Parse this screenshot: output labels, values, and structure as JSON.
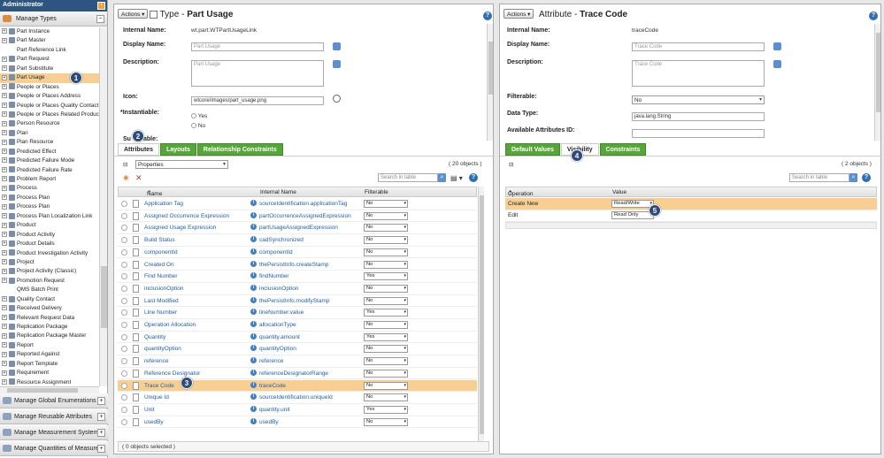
{
  "left": {
    "header": "Administrator",
    "manage_types": "Manage Types",
    "tree": [
      {
        "label": "Part Instance",
        "exp": true
      },
      {
        "label": "Part Master",
        "exp": true
      },
      {
        "label": "Part Reference Link",
        "exp": false
      },
      {
        "label": "Part Request",
        "exp": true
      },
      {
        "label": "Part Substitute",
        "exp": true
      },
      {
        "label": "Part Usage",
        "exp": true,
        "selected": true
      },
      {
        "label": "People or Places",
        "exp": true
      },
      {
        "label": "People or Places Address",
        "exp": true
      },
      {
        "label": "People or Places Quality Contact",
        "exp": true
      },
      {
        "label": "People or Places Related Product",
        "exp": true
      },
      {
        "label": "Person Resource",
        "exp": true
      },
      {
        "label": "Plan",
        "exp": true
      },
      {
        "label": "Plan Resource",
        "exp": true
      },
      {
        "label": "Predicted Effect",
        "exp": true
      },
      {
        "label": "Predicted Failure Mode",
        "exp": true
      },
      {
        "label": "Predicted Failure Rate",
        "exp": true
      },
      {
        "label": "Problem Report",
        "exp": true
      },
      {
        "label": "Process",
        "exp": true
      },
      {
        "label": "Process Plan",
        "exp": true
      },
      {
        "label": "Process Plan",
        "exp": true
      },
      {
        "label": "Process Plan Localization Link",
        "exp": true
      },
      {
        "label": "Product",
        "exp": true
      },
      {
        "label": "Product Activity",
        "exp": true
      },
      {
        "label": "Product Details",
        "exp": true
      },
      {
        "label": "Product Investigation Activity",
        "exp": true
      },
      {
        "label": "Project",
        "exp": true
      },
      {
        "label": "Project Activity (Classic)",
        "exp": true
      },
      {
        "label": "Promotion Request",
        "exp": true
      },
      {
        "label": "QMS Batch Print",
        "exp": false
      },
      {
        "label": "Quality Contact",
        "exp": true
      },
      {
        "label": "Received Delivery",
        "exp": true
      },
      {
        "label": "Relevant Request Data",
        "exp": true
      },
      {
        "label": "Replication Package",
        "exp": true
      },
      {
        "label": "Replication Package Master",
        "exp": true
      },
      {
        "label": "Report",
        "exp": true
      },
      {
        "label": "Reported Against",
        "exp": true
      },
      {
        "label": "Report Template",
        "exp": true
      },
      {
        "label": "Requirement",
        "exp": true
      },
      {
        "label": "Resource Assignment",
        "exp": true
      }
    ],
    "accordions": [
      "Manage Global Enumerations",
      "Manage Reusable Attributes",
      "Manage Measurement Systems",
      "Manage Quantities of Measure"
    ]
  },
  "mid": {
    "actions": "Actions",
    "title_prefix": "Type -",
    "title": "Part Usage",
    "internal_name_label": "Internal Name:",
    "internal_name": "wt.part.WTPartUsageLink",
    "display_name_label": "Display Name:",
    "display_name": "Part Usage",
    "description_label": "Description:",
    "description": "Part Usage",
    "icon_label": "Icon:",
    "icon_value": "wtcore/images/part_usage.png",
    "instantiable_label": "Instantiable:",
    "instantiable_required": "*",
    "yes": "Yes",
    "no": "No",
    "sub_label": "Su",
    "sub_label_tail": "able:",
    "tabs": [
      "Attributes",
      "Layouts",
      "Relationship Constraints"
    ],
    "view": "Properties",
    "count": "( 20 objects )",
    "search_placeholder": "Search in table",
    "columns": [
      "Name",
      "Internal Name",
      "Filterable"
    ],
    "rows": [
      {
        "name": "Application Tag",
        "iname": "sourceIdentification.applicationTag",
        "filt": "No"
      },
      {
        "name": "Assigned Occurrence Expression",
        "iname": "partOccurrenceAssignedExpression",
        "filt": "No"
      },
      {
        "name": "Assigned Usage Expression",
        "iname": "partUsageAssignedExpression",
        "filt": "No"
      },
      {
        "name": "Build Status",
        "iname": "cadSynchronized",
        "filt": "No"
      },
      {
        "name": "componentId",
        "iname": "componentId",
        "filt": "No"
      },
      {
        "name": "Created On",
        "iname": "thePersistInfo.createStamp",
        "filt": "No"
      },
      {
        "name": "Find Number",
        "iname": "findNumber",
        "filt": "Yes"
      },
      {
        "name": "inclusionOption",
        "iname": "inclusionOption",
        "filt": "No"
      },
      {
        "name": "Last Modified",
        "iname": "thePersistInfo.modifyStamp",
        "filt": "No"
      },
      {
        "name": "Line Number",
        "iname": "lineNumber.value",
        "filt": "Yes"
      },
      {
        "name": "Operation Allocation",
        "iname": "allocationType",
        "filt": "No"
      },
      {
        "name": "Quantity",
        "iname": "quantity.amount",
        "filt": "Yes"
      },
      {
        "name": "quantityOption",
        "iname": "quantityOption",
        "filt": "No"
      },
      {
        "name": "reference",
        "iname": "reference",
        "filt": "No"
      },
      {
        "name": "Reference Designator",
        "iname": "referenceDesignatorRange",
        "filt": "No"
      },
      {
        "name": "Trace Code",
        "iname": "traceCode",
        "filt": "No",
        "hl": true
      },
      {
        "name": "Unique Id",
        "iname": "sourceIdentification.uniqueId",
        "filt": "No"
      },
      {
        "name": "Unit",
        "iname": "quantity.unit",
        "filt": "Yes"
      },
      {
        "name": "usedBy",
        "iname": "usedBy",
        "filt": "No"
      }
    ],
    "footer": "( 0 objects selected )"
  },
  "right": {
    "actions": "Actions",
    "title_prefix": "Attribute -",
    "title": "Trace Code",
    "internal_name_label": "Internal Name:",
    "internal_name": "traceCode",
    "display_name_label": "Display Name:",
    "display_name": "Trace Code",
    "description_label": "Description:",
    "description": "Trace Code",
    "filterable_label": "Filterable:",
    "filterable": "No",
    "data_type_label": "Data Type:",
    "data_type": "java.lang.String",
    "avail_label": "Available Attributes ID:",
    "tabs": [
      "Default Values",
      "Visibility",
      "Constraints"
    ],
    "count": "( 2 objects )",
    "search_placeholder": "Search in table",
    "columns": [
      "Operation",
      "Value"
    ],
    "rows": [
      {
        "op": "Create New",
        "val": "Read/Write",
        "hl": true
      },
      {
        "op": "Edit",
        "val": "Read Only"
      }
    ]
  },
  "badges": [
    "1",
    "2",
    "3",
    "4",
    "5"
  ]
}
